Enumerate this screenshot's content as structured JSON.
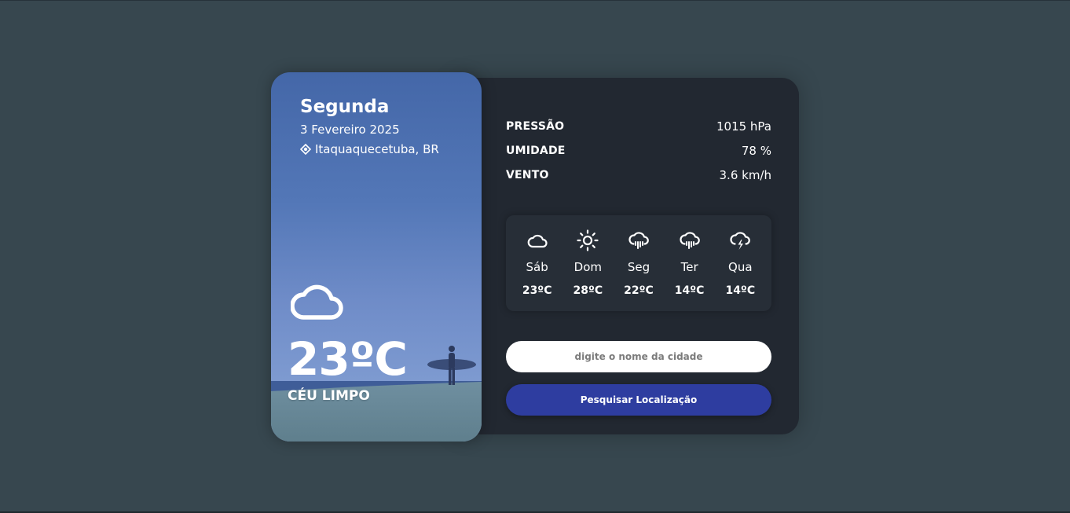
{
  "weather": {
    "day": "Segunda",
    "date": "3 Fevereiro 2025",
    "location": "Itaquaquecetuba, BR",
    "location_icon": "location-pin-icon",
    "icon": "cloud-icon",
    "temperature": "23ºC",
    "description": "CÉU LIMPO"
  },
  "stats": [
    {
      "label": "PRESSÃO",
      "value": "1015 hPa"
    },
    {
      "label": "UMIDADE",
      "value": "78 %"
    },
    {
      "label": "VENTO",
      "value": "3.6 km/h"
    }
  ],
  "forecast": [
    {
      "day": "Sáb",
      "temp": "23ºC",
      "icon": "cloud-icon"
    },
    {
      "day": "Dom",
      "temp": "28ºC",
      "icon": "sun-icon"
    },
    {
      "day": "Seg",
      "temp": "22ºC",
      "icon": "cloud-rain-icon"
    },
    {
      "day": "Ter",
      "temp": "14ºC",
      "icon": "cloud-rain-icon"
    },
    {
      "day": "Qua",
      "temp": "14ºC",
      "icon": "cloud-lightning-icon"
    }
  ],
  "search": {
    "placeholder": "digite o nome da cidade",
    "value": "",
    "button_label": "Pesquisar Localização"
  },
  "colors": {
    "background": "#37474f",
    "panel": "#222831",
    "accent_button": "#2e3da0"
  }
}
